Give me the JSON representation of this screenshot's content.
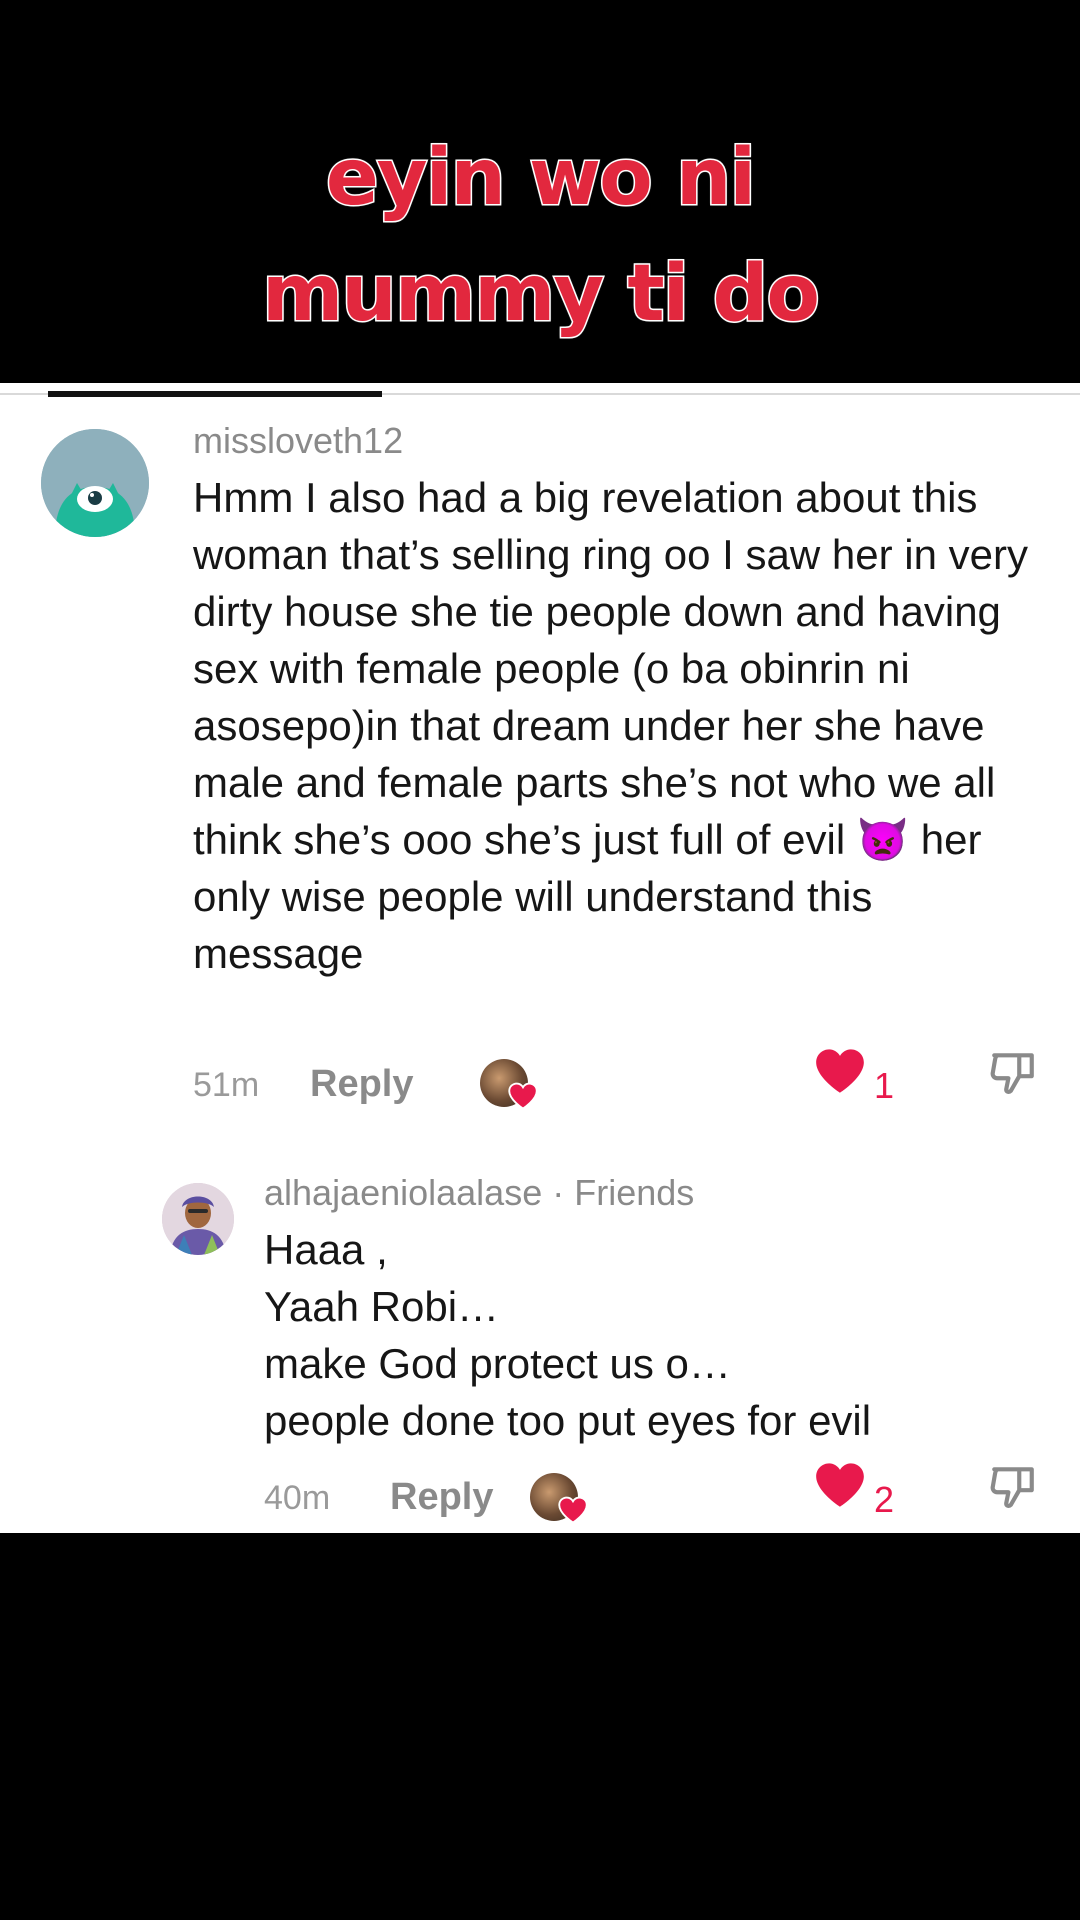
{
  "video": {
    "overlay_line1": "eyin wo ni",
    "overlay_line2": "mummy ti do"
  },
  "colors": {
    "like_red": "#e8194c",
    "overlay_red": "#e2283e",
    "muted_gray": "#8a8a8a",
    "avatar_teal": "#1fb89a"
  },
  "comments": [
    {
      "username": "missloveth12",
      "avatar_icon": "teal-monster-avatar",
      "text": "Hmm I also had a big revelation about this woman that’s selling ring oo I saw her in very dirty house she tie people down and having sex with female people (o ba obinrin ni asosepo)in that dream under her she have male and female parts she’s not who we all think she’s ooo she’s just full of evil 👿 her only wise people will understand this message",
      "time": "51m",
      "reply_label": "Reply",
      "likes": "1"
    },
    {
      "username": "alhajaeniolaalase",
      "friends_tag": " · Friends",
      "text": "Haaa ,\nYaah Robi…\nmake God protect us o…\npeople done too put eyes for evil",
      "time": "40m",
      "reply_label": "Reply",
      "likes": "2"
    }
  ]
}
